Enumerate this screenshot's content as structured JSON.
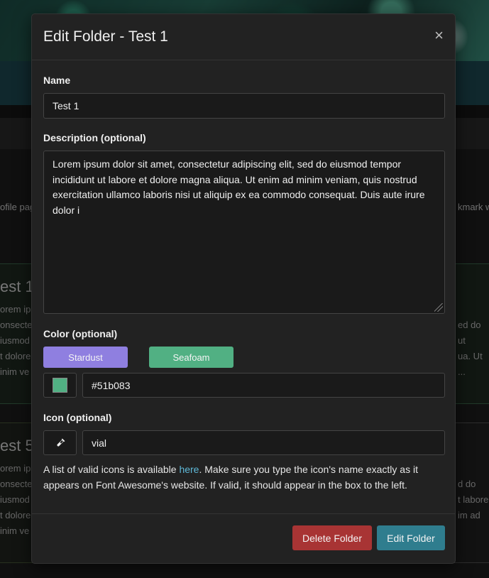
{
  "background": {
    "left_text": "ofile pag",
    "right_text": "kmark w",
    "cards": [
      {
        "title": "est 1",
        "lines": [
          "orem ip",
          "onsecte",
          "iusmod",
          "t dolore",
          "inim ve"
        ]
      },
      {
        "title": "est 5",
        "lines": [
          "orem ips",
          "onsecte",
          "iusmod",
          "t dolore",
          "inim ve"
        ]
      }
    ],
    "right_card_lines_1": [
      "ed do",
      "ut",
      "ua. Ut",
      "..."
    ],
    "right_card_lines_2": [
      "d do",
      "t labore",
      "im ad"
    ]
  },
  "modal": {
    "title": "Edit Folder - Test 1",
    "close_symbol": "×",
    "name_label": "Name",
    "name_value": "Test 1",
    "description_label": "Description (optional)",
    "description_value": "Lorem ipsum dolor sit amet, consectetur adipiscing elit, sed do eiusmod tempor incididunt ut labore et dolore magna aliqua. Ut enim ad minim veniam, quis nostrud exercitation ullamco laboris nisi ut aliquip ex ea commodo consequat. Duis aute irure dolor i",
    "color_label": "Color (optional)",
    "color_presets": [
      {
        "label": "Stardust",
        "color": "#8f7fe0"
      },
      {
        "label": "Seafoam",
        "color": "#51b083"
      }
    ],
    "color_value": "#51b083",
    "swatch_color": "#51b083",
    "icon_label": "Icon (optional)",
    "icon_name": "vial-icon",
    "icon_value": "vial",
    "help_before": "A list of valid icons is available ",
    "help_link": "here",
    "help_after": ". Make sure you type the icon's name exactly as it appears on Font Awesome's website. If valid, it should appear in the box to the left.",
    "delete_label": "Delete Folder",
    "edit_label": "Edit Folder"
  },
  "colors": {
    "delete_button": "#a83434",
    "edit_button": "#2f7d8e",
    "link": "#5fb9d8"
  }
}
